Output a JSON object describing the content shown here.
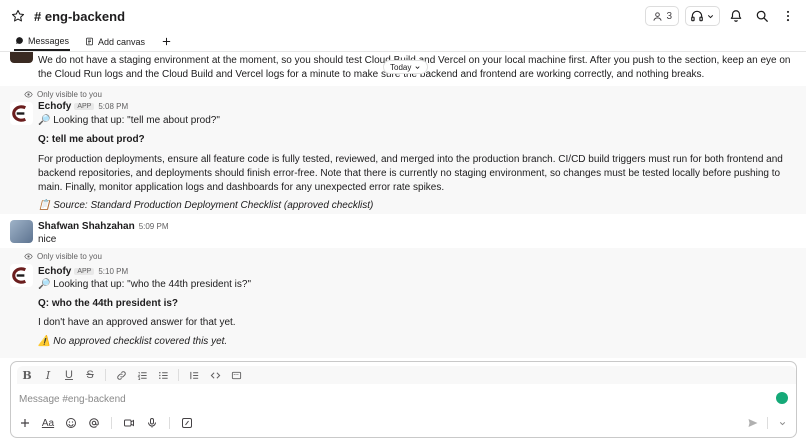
{
  "header": {
    "channel_name": "# eng-backend",
    "member_count": "3"
  },
  "tabs": [
    {
      "label": "Messages"
    },
    {
      "label": "Add canvas"
    }
  ],
  "today_label": "Today",
  "messages": {
    "truncated_text": "We do not have a staging environment at the moment, so you should test Cloud Build and Vercel on your local machine first. After you push to the section, keep an eye on the Cloud Run logs and the Cloud Build and Vercel logs for a minute to make sure the backend and frontend are working correctly, and nothing breaks.",
    "echofy_1": {
      "only_visible": "Only visible to you",
      "name": "Echofy",
      "badge": "APP",
      "time": "5:08 PM",
      "lookup": "🔎 Looking that up: \"tell me about prod?\"",
      "question": "Q: tell me about prod?",
      "answer": "For production deployments, ensure all feature code is fully tested, reviewed, and merged into the production branch. CI/CD build triggers must run for both frontend and backend repositories, and deployments should finish error-free. Note that there is currently no staging environment, so changes must be tested locally before pushing to main. Finally, monitor application logs and dashboards for any unexpected error rate spikes.",
      "source": "📋 Source: Standard Production Deployment Checklist (approved checklist)"
    },
    "user_msg": {
      "name": "Shafwan Shahzahan",
      "time": "5:09 PM",
      "text": "nice"
    },
    "echofy_2": {
      "only_visible": "Only visible to you",
      "name": "Echofy",
      "badge": "APP",
      "time": "5:10 PM",
      "lookup": "🔎 Looking that up: \"who the 44th president is?\"",
      "question": "Q: who the 44th president is?",
      "answer": "I don't have an approved answer for that yet.",
      "warning": "⚠️ No approved checklist covered this yet."
    }
  },
  "composer": {
    "placeholder": "Message #eng-backend"
  },
  "colors": {
    "text": "#1d1c1d",
    "muted": "#616061",
    "highlight_bg": "#f8f8f8",
    "grammarly": "#15a978"
  }
}
